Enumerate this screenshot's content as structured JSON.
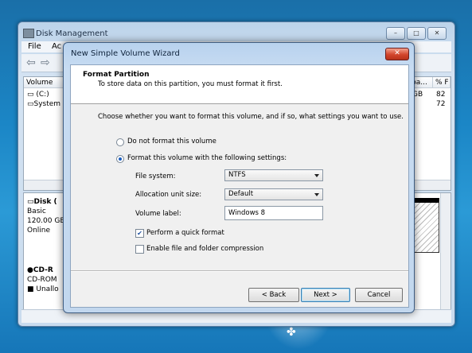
{
  "desktop": {
    "logo": "✤"
  },
  "disk_mgmt": {
    "title": "Disk Management",
    "minimize": "–",
    "maximize": "□",
    "close": "✕",
    "menu": [
      "File",
      "Ac"
    ],
    "back_arrow": "⇦",
    "fwd_arrow": "⇨",
    "columns": [
      "Volume",
      "pa...",
      "% F"
    ],
    "volumes": [
      {
        "name": "(C:)",
        "cap": "GB",
        "pct": "82"
      },
      {
        "name": "System",
        "cap": "",
        "pct": "72"
      }
    ],
    "disk0": {
      "name": "Disk (",
      "type": "Basic",
      "size": "120.00 GE",
      "status": "Online"
    },
    "cdrom": {
      "name": "CD-R",
      "type": "CD-ROM",
      "status": "Unallo"
    }
  },
  "wizard": {
    "title": "New Simple Volume Wizard",
    "close": "✕",
    "header_title": "Format Partition",
    "header_subtitle": "To store data on this partition, you must format it first.",
    "prompt": "Choose whether you want to format this volume, and if so, what settings you want to use.",
    "option_no_format": "Do not format this volume",
    "option_format": "Format this volume with the following settings:",
    "file_system_label": "File system:",
    "file_system_value": "NTFS",
    "alloc_label": "Allocation unit size:",
    "alloc_value": "Default",
    "volume_label_label": "Volume label:",
    "volume_label_value": "Windows 8",
    "quick_format_label": "Perform a quick format",
    "compression_label": "Enable file and folder compression",
    "back_button": "< Back",
    "next_button": "Next >",
    "cancel_button": "Cancel",
    "check_mark": "✔"
  }
}
